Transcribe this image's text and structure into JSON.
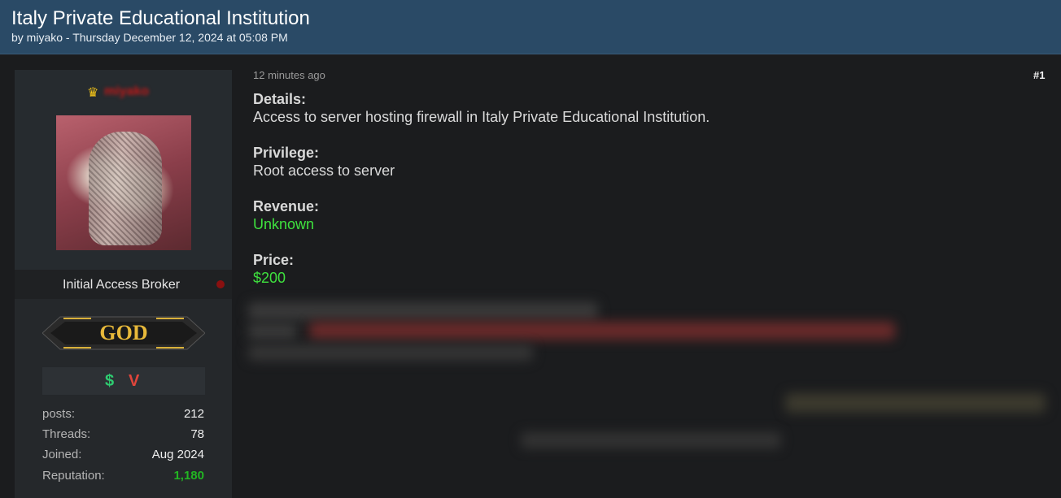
{
  "thread": {
    "title": "Italy Private Educational Institution",
    "meta": "by miyako - Thursday December 12, 2024 at 05:08 PM"
  },
  "user": {
    "crown_icon": "crown-icon",
    "title": "Initial Access Broker",
    "rank": "GOD",
    "badges": [
      "dollar-icon",
      "v-icon"
    ],
    "stats": {
      "posts_label": "posts:",
      "posts": "212",
      "threads_label": "Threads:",
      "threads": "78",
      "joined_label": "Joined:",
      "joined": "Aug 2024",
      "reputation_label": "Reputation:",
      "reputation": "1,180"
    }
  },
  "post": {
    "time": "12 minutes ago",
    "number": "#1",
    "details_label": "Details:",
    "details": "Access to server hosting firewall in Italy Private Educational Institution.",
    "privilege_label": "Privilege:",
    "privilege": "Root access to server",
    "revenue_label": "Revenue:",
    "revenue": "Unknown",
    "price_label": "Price:",
    "price": "$200"
  },
  "colors": {
    "header_bg": "#2a4a66",
    "page_bg": "#1b1c1e",
    "green_value": "#3ee13e",
    "reputation_green": "#22b522"
  }
}
